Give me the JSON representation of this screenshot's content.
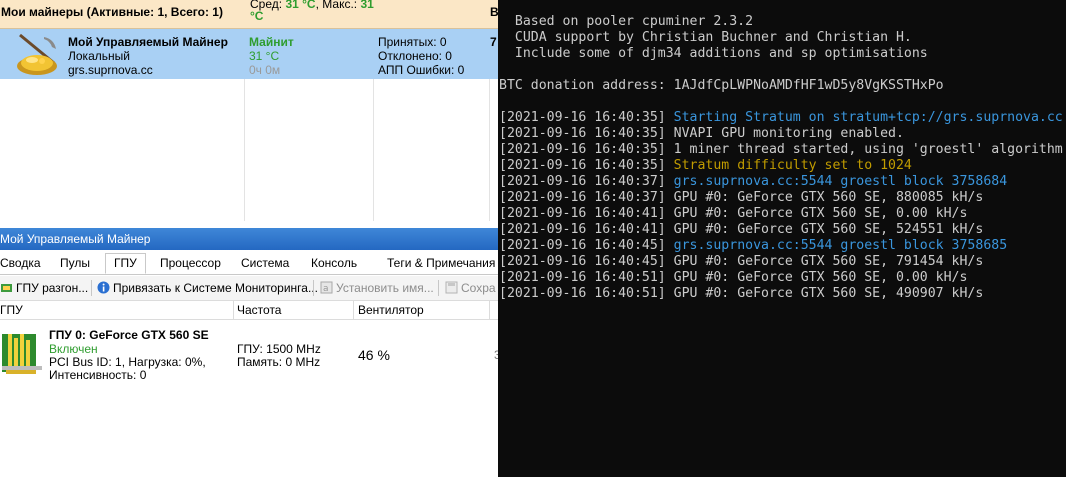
{
  "miners_header": {
    "title": "Мои майнеры (Активные: 1, Всего: 1)",
    "temp_prefix": "Сред:",
    "temp_avg": "31 °C",
    "temp_max_prefix": ", Макс.:",
    "temp_max": "31 °C",
    "cut_label": "В"
  },
  "miner": {
    "name": "Мой Управляемый Майнер",
    "type": "Локальный",
    "pool": "grs.suprnova.cc",
    "status": "Майнит",
    "temp": "31 °C",
    "uptime": "0ч 0м",
    "accepted": "Принятых: 0",
    "rejected": "Отклонено: 0",
    "errors": "АПП Ошибки: 0",
    "extra": "7"
  },
  "panel": {
    "title": "Мой Управляемый Майнер",
    "tabs": [
      "Сводка",
      "Пулы",
      "ГПУ",
      "Процессор",
      "Система",
      "Консоль",
      "Теги & Примечания"
    ],
    "active_tab": "ГПУ",
    "toolbar": {
      "overclock": "ГПУ разгон...",
      "bind": "Привязать к Системе Мониторинга...",
      "rename": "Установить имя...",
      "save": "Сохра"
    },
    "columns": {
      "gpu": "ГПУ",
      "freq": "Частота",
      "fan": "Вентилятор"
    }
  },
  "gpu": {
    "name": "ГПУ 0: GeForce GTX 560 SE",
    "state": "Включен",
    "bus": "PCI Bus ID: 1, Нагрузка: 0%,",
    "intensity": "Интенсивность: 0",
    "freq": "ГПУ: 1500 MHz",
    "mem": "Память: 0 MHz",
    "fan": "46 %",
    "cut": "3"
  },
  "console": {
    "lines": [
      {
        "text": "  Based on pooler cpuminer 2.3.2",
        "color": ""
      },
      {
        "text": "  CUDA support by Christian Buchner and Christian H.",
        "color": ""
      },
      {
        "text": "  Include some of djm34 additions and sp optimisations",
        "color": ""
      },
      {
        "text": "",
        "color": ""
      },
      {
        "text": "BTC donation address: 1AJdfCpLWPNoAMDfHF1wD5y8VgKSSTHxPo",
        "color": ""
      },
      {
        "text": "",
        "color": ""
      },
      {
        "time": "[2021-09-16 16:40:35]",
        "text": " Starting Stratum on stratum+tcp://grs.suprnova.cc",
        "color": "blue"
      },
      {
        "time": "[2021-09-16 16:40:35]",
        "text": " NVAPI GPU monitoring enabled.",
        "color": ""
      },
      {
        "time": "[2021-09-16 16:40:35]",
        "text": " 1 miner thread started, using 'groestl' algorithm",
        "color": ""
      },
      {
        "time": "[2021-09-16 16:40:35]",
        "text": " Stratum difficulty set to 1024",
        "color": "yellow"
      },
      {
        "time": "[2021-09-16 16:40:37]",
        "text": " grs.suprnova.cc:5544 groestl block 3758684",
        "color": "blue"
      },
      {
        "time": "[2021-09-16 16:40:37]",
        "text": " GPU #0: GeForce GTX 560 SE, 880085 kH/s",
        "color": ""
      },
      {
        "time": "[2021-09-16 16:40:41]",
        "text": " GPU #0: GeForce GTX 560 SE, 0.00 kH/s",
        "color": ""
      },
      {
        "time": "[2021-09-16 16:40:41]",
        "text": " GPU #0: GeForce GTX 560 SE, 524551 kH/s",
        "color": ""
      },
      {
        "time": "[2021-09-16 16:40:45]",
        "text": " grs.suprnova.cc:5544 groestl block 3758685",
        "color": "blue"
      },
      {
        "time": "[2021-09-16 16:40:45]",
        "text": " GPU #0: GeForce GTX 560 SE, 791454 kH/s",
        "color": ""
      },
      {
        "time": "[2021-09-16 16:40:51]",
        "text": " GPU #0: GeForce GTX 560 SE, 0.00 kH/s",
        "color": ""
      },
      {
        "time": "[2021-09-16 16:40:51]",
        "text": " GPU #0: GeForce GTX 560 SE, 490907 kH/s",
        "color": ""
      }
    ]
  }
}
